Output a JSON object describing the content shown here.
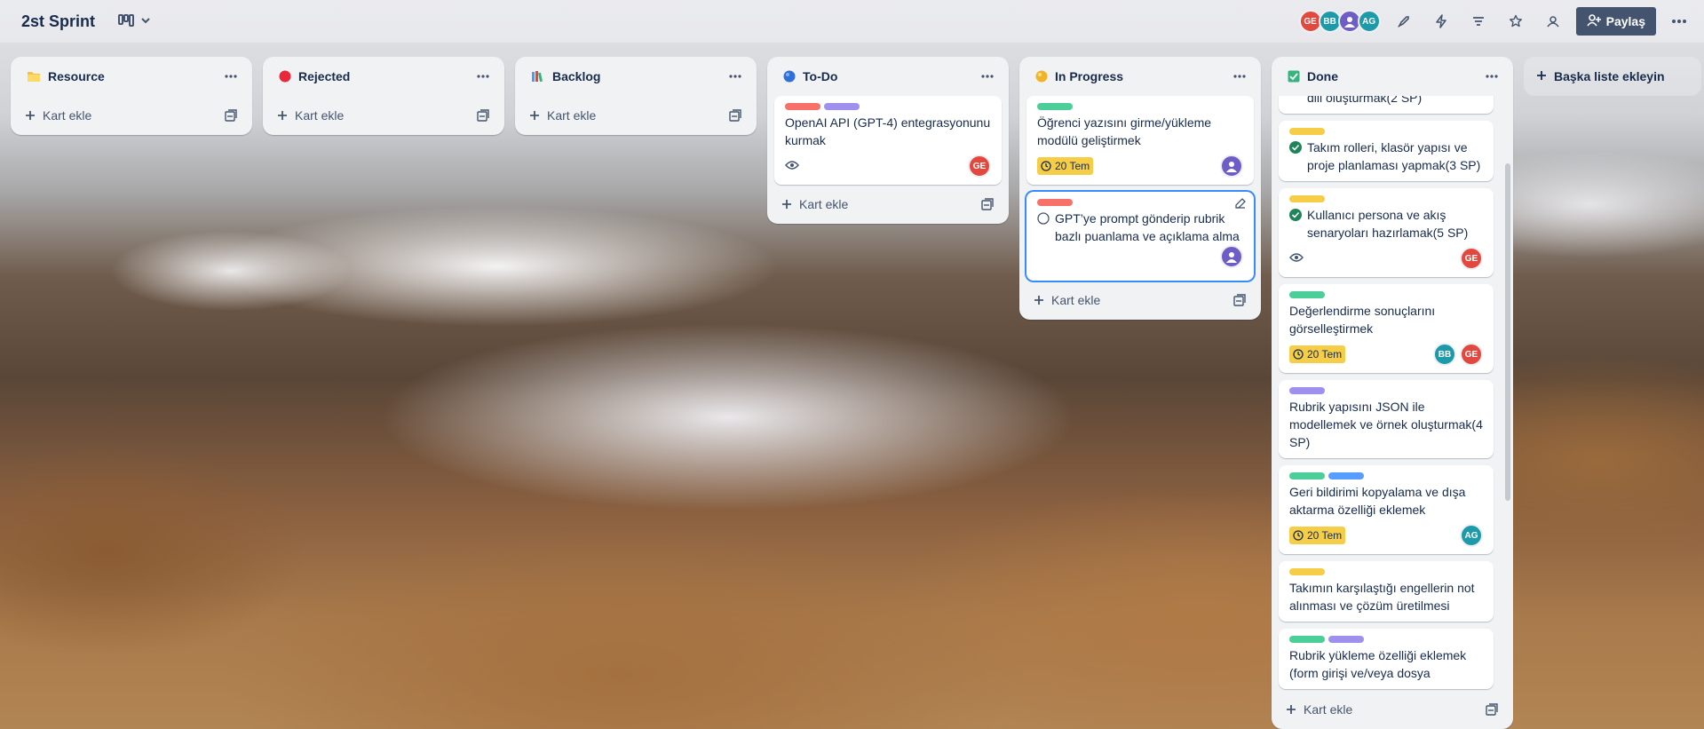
{
  "board": {
    "title": "2st Sprint"
  },
  "header": {
    "members": [
      {
        "initials": "GE",
        "color": "#e2483d"
      },
      {
        "initials": "BB",
        "color": "#1d9aaa"
      },
      {
        "initials": "",
        "color": "#6e5dc6"
      },
      {
        "initials": "AG",
        "color": "#1d9aaa"
      }
    ],
    "share_label": "Paylaş"
  },
  "add_card_label": "Kart ekle",
  "add_list_label": "Başka liste ekleyin",
  "colors": {
    "label_red": "#f87168",
    "label_purple": "#9f8fef",
    "label_green": "#4bce97",
    "label_yellow": "#f5cd47",
    "label_blue": "#579dff",
    "due_yellow": "#f5cd47",
    "done_check": "#1f845a"
  },
  "lists": [
    {
      "name": "Resource",
      "emoji": "folder-icon",
      "cards": []
    },
    {
      "name": "Rejected",
      "emoji": "red-circle-icon",
      "cards": []
    },
    {
      "name": "Backlog",
      "emoji": "books-icon",
      "cards": []
    },
    {
      "name": "To-Do",
      "emoji": "blue-circle-icon",
      "cards": [
        {
          "labels": [
            "red",
            "purple"
          ],
          "title": "OpenAI API (GPT-4) entegrasyonunu kurmak",
          "watch": true,
          "members": [
            "GE"
          ]
        }
      ]
    },
    {
      "name": "In Progress",
      "emoji": "yellow-circle-icon",
      "cards": [
        {
          "labels": [
            "green"
          ],
          "title": "Öğrenci yazısını girme/yükleme modülü geliştirmek",
          "due": "20 Tem",
          "members": [
            "user"
          ]
        },
        {
          "labels": [
            "red"
          ],
          "title": "GPT’ye prompt gönderip rubrik bazlı puanlama ve açıklama alma",
          "members": [
            "user"
          ],
          "selected": true
        }
      ]
    },
    {
      "name": "Done",
      "emoji": "check-box-icon",
      "cards": [
        {
          "labels": [],
          "title": "dili oluşturmak(2 SP)"
        },
        {
          "labels": [
            "yellow"
          ],
          "title": "Takım rolleri, klasör yapısı ve proje planlaması yapmak(3 SP)",
          "done": true
        },
        {
          "labels": [
            "yellow"
          ],
          "title": "Kullanıcı persona ve akış senaryoları hazırlamak(5 SP)",
          "done": true,
          "watch": true,
          "members": [
            "GE"
          ]
        },
        {
          "labels": [
            "green"
          ],
          "title": "Değerlendirme sonuçlarını görselleştirmek",
          "due": "20 Tem",
          "members": [
            "BB",
            "GE"
          ]
        },
        {
          "labels": [
            "purple"
          ],
          "title": "Rubrik yapısını JSON ile modellemek ve örnek oluşturmak(4 SP)"
        },
        {
          "labels": [
            "green",
            "blue"
          ],
          "title": "Geri bildirimi kopyalama ve dışa aktarma özelliği eklemek",
          "due": "20 Tem",
          "members": [
            "AG"
          ]
        },
        {
          "labels": [
            "yellow"
          ],
          "title": "Takımın karşılaştığı engellerin not alınması ve çözüm üretilmesi"
        },
        {
          "labels": [
            "green",
            "purple"
          ],
          "title": "Rubrik yükleme özelliği eklemek (form girişi ve/veya dosya"
        }
      ]
    }
  ]
}
